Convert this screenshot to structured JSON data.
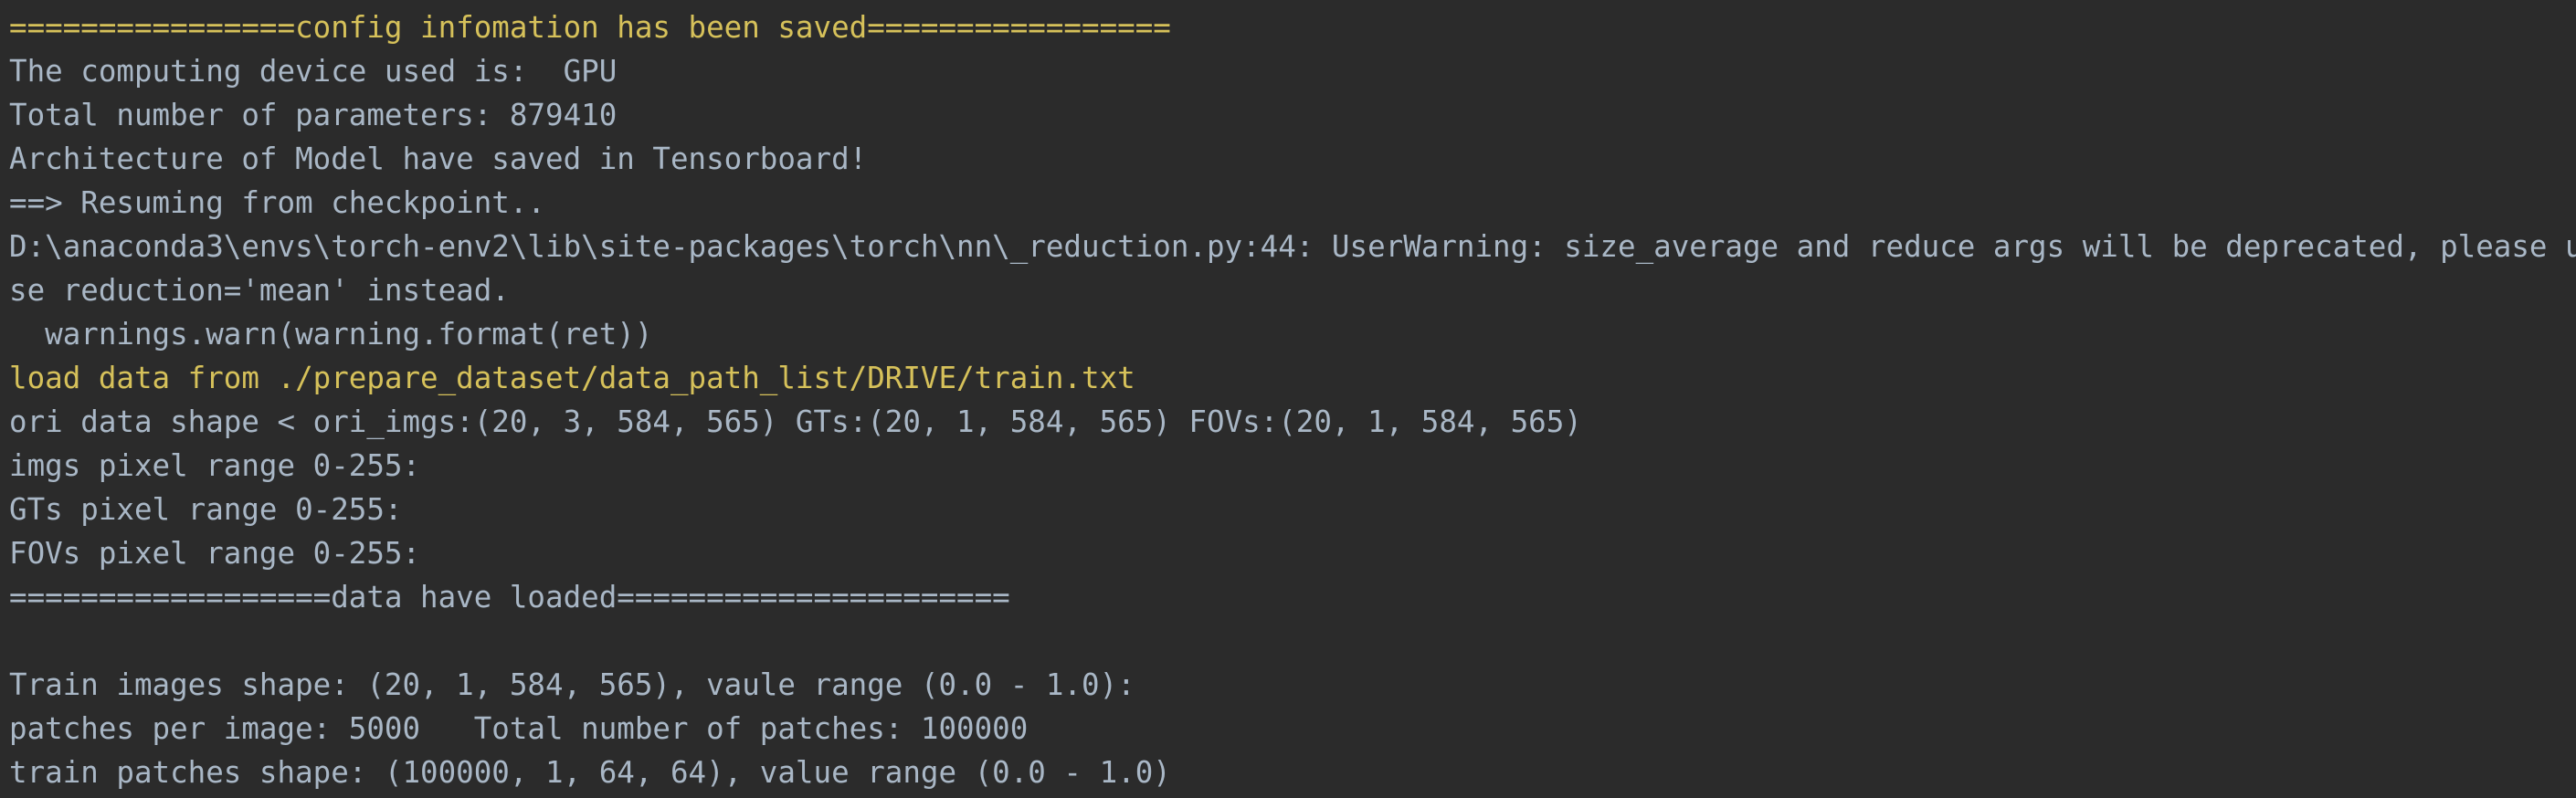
{
  "console": {
    "lines": [
      {
        "text": "================config infomation has been saved=================",
        "color": "#d6c15a"
      },
      {
        "text": "The computing device used is:  GPU",
        "color": "#a9b7c6"
      },
      {
        "text": "Total number of parameters: 879410",
        "color": "#a9b7c6"
      },
      {
        "text": "Architecture of Model have saved in Tensorboard!",
        "color": "#a9b7c6"
      },
      {
        "text": "==> Resuming from checkpoint..",
        "color": "#a9b7c6"
      },
      {
        "text": "D:\\anaconda3\\envs\\torch-env2\\lib\\site-packages\\torch\\nn\\_reduction.py:44: UserWarning: size_average and reduce args will be deprecated, please u",
        "color": "#a9b7c6"
      },
      {
        "text": "se reduction='mean' instead.",
        "color": "#a9b7c6"
      },
      {
        "text": "  warnings.warn(warning.format(ret))",
        "color": "#a9b7c6"
      },
      {
        "text": "load data from ./prepare_dataset/data_path_list/DRIVE/train.txt",
        "color": "#d6c15a"
      },
      {
        "text": "ori data shape < ori_imgs:(20, 3, 584, 565) GTs:(20, 1, 584, 565) FOVs:(20, 1, 584, 565)",
        "color": "#a9b7c6"
      },
      {
        "text": "imgs pixel range 0-255:",
        "color": "#a9b7c6"
      },
      {
        "text": "GTs pixel range 0-255:",
        "color": "#a9b7c6"
      },
      {
        "text": "FOVs pixel range 0-255:",
        "color": "#a9b7c6"
      },
      {
        "text": "==================data have loaded======================",
        "color": "#a9b7c6"
      },
      {
        "text": "",
        "color": "#a9b7c6"
      },
      {
        "text": "Train images shape: (20, 1, 584, 565), vaule range (0.0 - 1.0):",
        "color": "#a9b7c6"
      },
      {
        "text": "patches per image: 5000   Total number of patches: 100000",
        "color": "#a9b7c6"
      },
      {
        "text": "train patches shape: (100000, 1, 64, 64), value range (0.0 - 1.0)",
        "color": "#a9b7c6"
      }
    ]
  }
}
